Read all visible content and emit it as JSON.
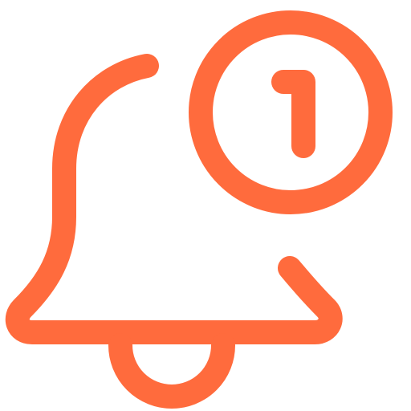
{
  "icon": {
    "name": "bell-notification-icon",
    "color": "#FF6B3D",
    "badge": {
      "count": "1"
    }
  }
}
